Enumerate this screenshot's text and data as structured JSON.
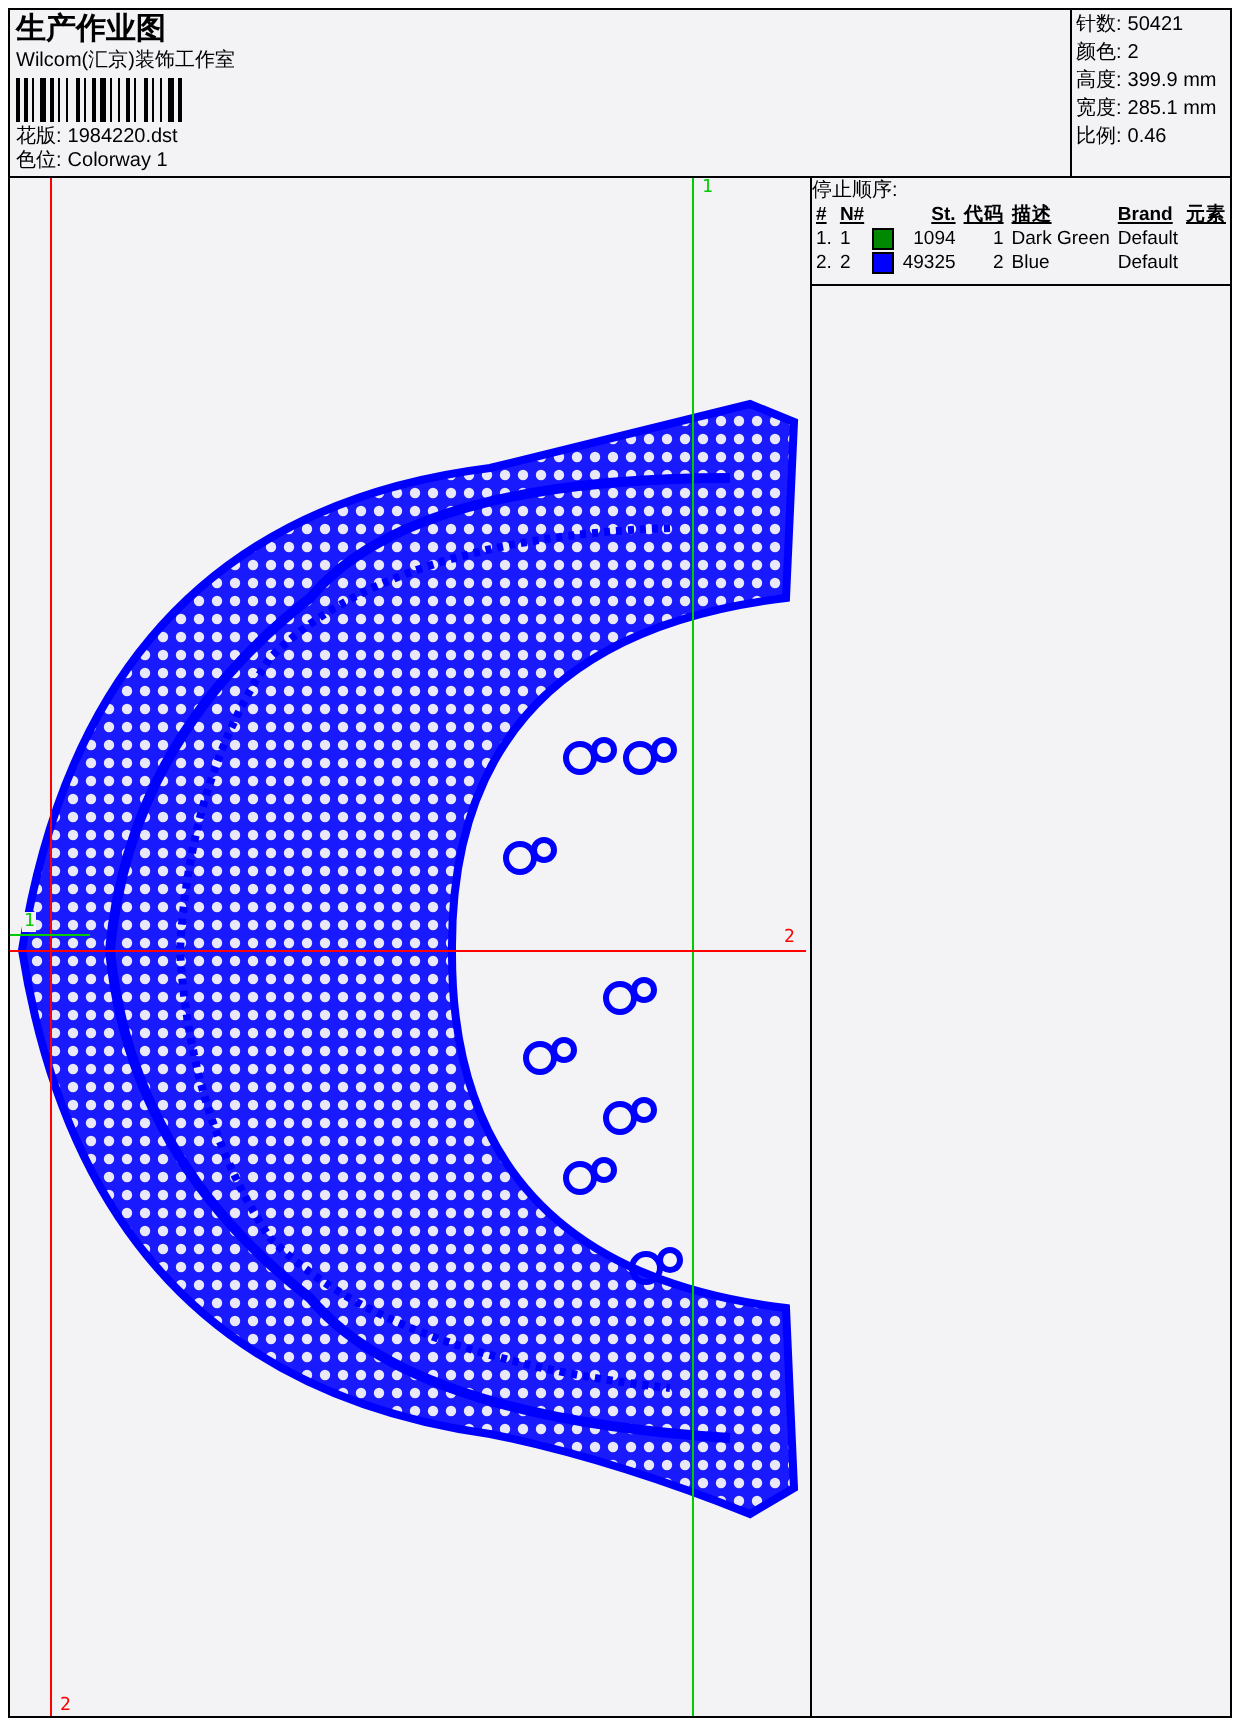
{
  "header": {
    "title": "生产作业图",
    "company": "Wilcom(汇京)装饰工作室",
    "design_file": {
      "label": "花版:",
      "value": "1984220.dst"
    },
    "colorway": {
      "label": "色位:",
      "value": "Colorway 1"
    }
  },
  "stats": [
    {
      "label": "针数:",
      "value": "50421"
    },
    {
      "label": "颜色:",
      "value": "2"
    },
    {
      "label": "高度:",
      "value": "399.9 mm"
    },
    {
      "label": "宽度:",
      "value": "285.1 mm"
    },
    {
      "label": "比例:",
      "value": "0.46"
    }
  ],
  "stop_sequence": {
    "title": "停止顺序:",
    "columns": [
      "#",
      "N#",
      "St.",
      "代码",
      "描述",
      "Brand",
      "元素"
    ],
    "rows": [
      {
        "index": "1.",
        "number": "1",
        "color": "#008800",
        "stitches": "1094",
        "code": "1",
        "description": "Dark Green",
        "brand": "Default"
      },
      {
        "index": "2.",
        "number": "2",
        "color": "#0000ff",
        "stitches": "49325",
        "code": "2",
        "description": "Blue",
        "brand": "Default"
      }
    ]
  },
  "canvas": {
    "guides": [
      {
        "kind": "vertical",
        "label": "1",
        "color": "#00cc00"
      },
      {
        "kind": "horizontal",
        "label": "2",
        "color": "#ff0000"
      },
      {
        "kind": "vertical",
        "label": "2",
        "color": "#ff0000"
      },
      {
        "kind": "horizontal",
        "label": "1",
        "color": "#00cc00"
      }
    ]
  }
}
